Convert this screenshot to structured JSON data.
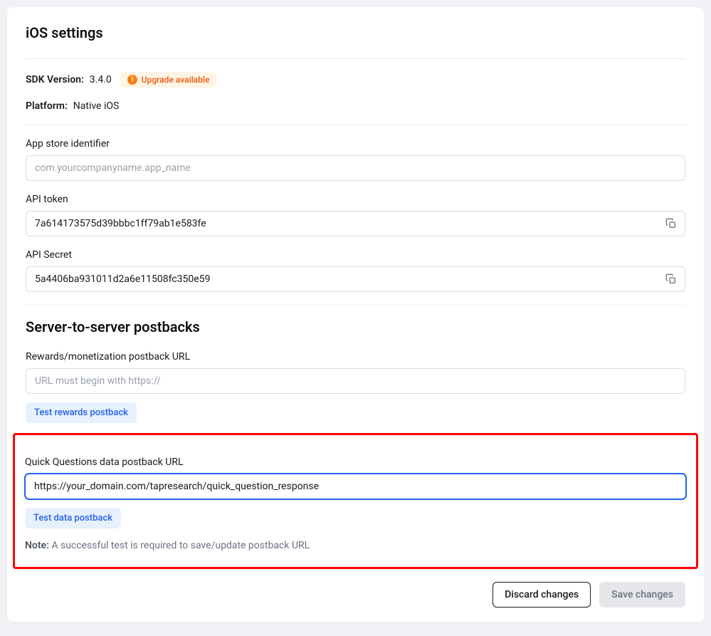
{
  "header": {
    "title": "iOS settings"
  },
  "meta": {
    "sdk_label": "SDK Version:",
    "sdk_value": "3.4.0",
    "upgrade_text": "Upgrade available",
    "platform_label": "Platform:",
    "platform_value": "Native iOS"
  },
  "fields": {
    "app_store": {
      "label": "App store identifier",
      "placeholder": "com.yourcompanyname.app_name",
      "value": ""
    },
    "api_token": {
      "label": "API token",
      "value": "7a614173575d39bbbc1ff79ab1e583fe"
    },
    "api_secret": {
      "label": "API Secret",
      "value": "5a4406ba931011d2a6e11508fc350e59"
    }
  },
  "postbacks": {
    "section_title": "Server-to-server postbacks",
    "rewards": {
      "label": "Rewards/monetization postback URL",
      "placeholder": "URL must begin with https://",
      "value": "",
      "test_button": "Test rewards postback"
    },
    "quick_questions": {
      "label": "Quick Questions data postback URL",
      "value": "https://your_domain.com/tapresearch/quick_question_response",
      "test_button": "Test data postback"
    },
    "note_label": "Note:",
    "note_text": "A successful test is required to save/update postback URL"
  },
  "actions": {
    "discard": "Discard changes",
    "save": "Save changes"
  }
}
